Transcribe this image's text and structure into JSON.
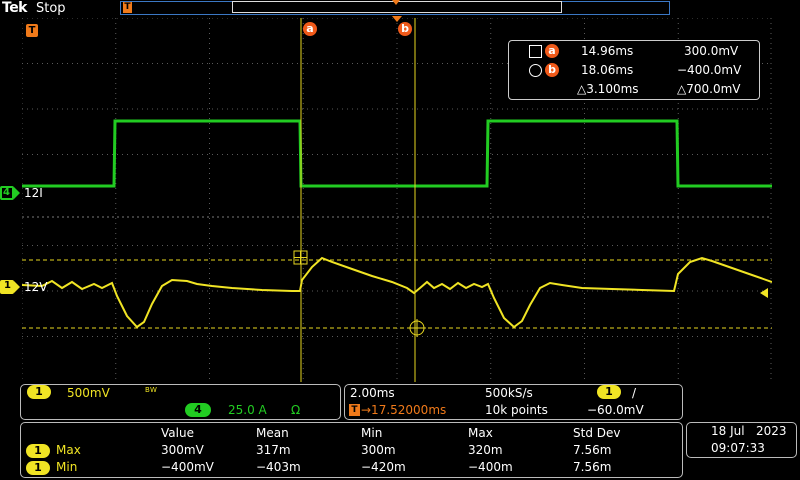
{
  "header": {
    "logo": "Tek",
    "run_state": "Stop",
    "trigger_marker": "T"
  },
  "markers": {
    "trigger": "T",
    "cursor_a": "a",
    "cursor_b": "b",
    "ch4_num": "4",
    "ch4_label": "12I",
    "ch1_num": "1",
    "ch1_label": "12V"
  },
  "cursor_readout": {
    "a_time": "14.96ms",
    "a_value": "300.0mV",
    "b_time": "18.06ms",
    "b_value": "−400.0mV",
    "delta_time": "△3.100ms",
    "delta_value": "△700.0mV"
  },
  "channel_panel": {
    "ch1_chip": "1",
    "ch1_scale": "500mV",
    "bw_flag": "B W",
    "ch4_chip": "4",
    "ch4_scale": "25.0 A",
    "ch4_term": "Ω"
  },
  "timebase_panel": {
    "horiz_scale": "2.00ms",
    "sample_rate": "500kS/s",
    "trig_chip": "1",
    "trig_slope": "/",
    "trig_pos_label": "T",
    "trig_pos": "→17.52000ms",
    "record_length": "10k points",
    "trig_level": "−60.0mV"
  },
  "measurements": {
    "headers": [
      "Value",
      "Mean",
      "Min",
      "Max",
      "Std Dev"
    ],
    "rows": [
      {
        "chip": "1",
        "name": "Max",
        "values": [
          "300mV",
          "317m",
          "300m",
          "320m",
          "7.56m"
        ]
      },
      {
        "chip": "1",
        "name": "Min",
        "values": [
          "−400mV",
          "−403m",
          "−420m",
          "−400m",
          "7.56m"
        ]
      }
    ]
  },
  "clock": {
    "date": "18 Jul   2023",
    "time": "09:07:33"
  },
  "colors": {
    "ch1": "#f0e424",
    "ch4": "#22cc22",
    "accent": "#f05a1a",
    "record_bar": "#3b78c5"
  }
}
